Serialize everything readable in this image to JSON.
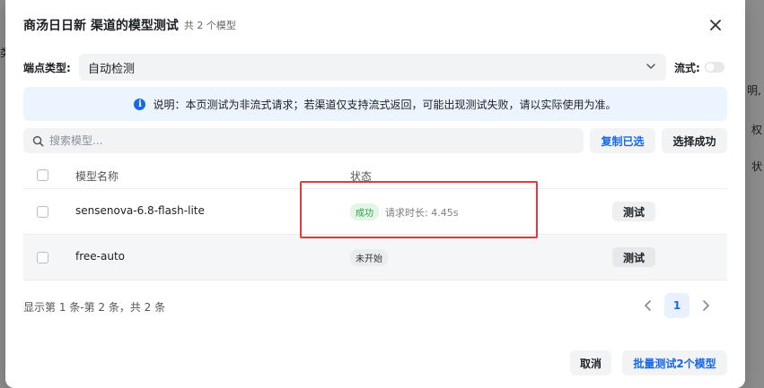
{
  "background": {
    "fragments": [
      "类",
      "明,",
      "权",
      "状"
    ]
  },
  "modal": {
    "title": "商汤日日新 渠道的模型测试",
    "subtitle": "共 2 个模型",
    "close_icon": "close-icon"
  },
  "endpoint": {
    "label": "端点类型:",
    "selected": "自动检测"
  },
  "stream": {
    "label": "流式:",
    "enabled": false
  },
  "info": {
    "icon": "info-icon",
    "text": "说明：本页测试为非流式请求；若渠道仅支持流式返回，可能出现测试失败，请以实际使用为准。"
  },
  "search": {
    "placeholder": "搜索模型...",
    "value": ""
  },
  "actions": {
    "copy_selected": "复制已选",
    "select_success": "选择成功"
  },
  "table": {
    "headers": {
      "name": "模型名称",
      "status": "状态"
    },
    "rows": [
      {
        "name": "sensenova-6.8-flash-lite",
        "status": "成功",
        "duration": "请求时长: 4.45s",
        "action": "测试"
      },
      {
        "name": "free-auto",
        "status": "未开始",
        "duration": "",
        "action": "测试"
      }
    ]
  },
  "pagination": {
    "summary": "显示第 1 条-第 2 条，共 2 条",
    "current_page": "1"
  },
  "footer": {
    "cancel": "取消",
    "batch_test": "批量测试2个模型"
  },
  "colors": {
    "accent": "#1769e6",
    "success_tag_bg": "#e2f5e6",
    "success_tag_text": "#2e9e47",
    "highlight_box": "#e0393e"
  }
}
